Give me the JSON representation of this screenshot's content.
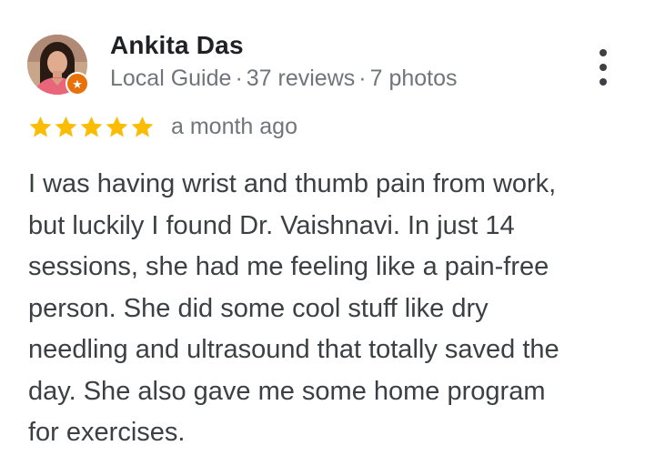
{
  "reviewer": {
    "name": "Ankita Das",
    "badge": "Local Guide",
    "reviews": "37 reviews",
    "photos": "7 photos",
    "separator": "·",
    "avatar_icon": "profile-photo",
    "badge_icon": "local-guide-star-icon"
  },
  "rating": {
    "stars": 5,
    "max_stars": 5,
    "star_color": "#fbbc04",
    "time_ago": "a month ago"
  },
  "review": {
    "lines": [
      "I was having wrist and thumb pain from work,",
      "but luckily I found Dr. Vaishnavi. In just 14",
      "sessions, she had me feeling like a pain-free",
      "person. She did some cool stuff like dry",
      "needling and ultrasound that totally saved the",
      "day. She also gave me some home program",
      "for exercises."
    ]
  },
  "actions": {
    "more_icon": "more-vert-icon"
  },
  "colors": {
    "name": "#202124",
    "meta": "#70757a",
    "text": "#3c4043",
    "badge": "#e8710a"
  }
}
